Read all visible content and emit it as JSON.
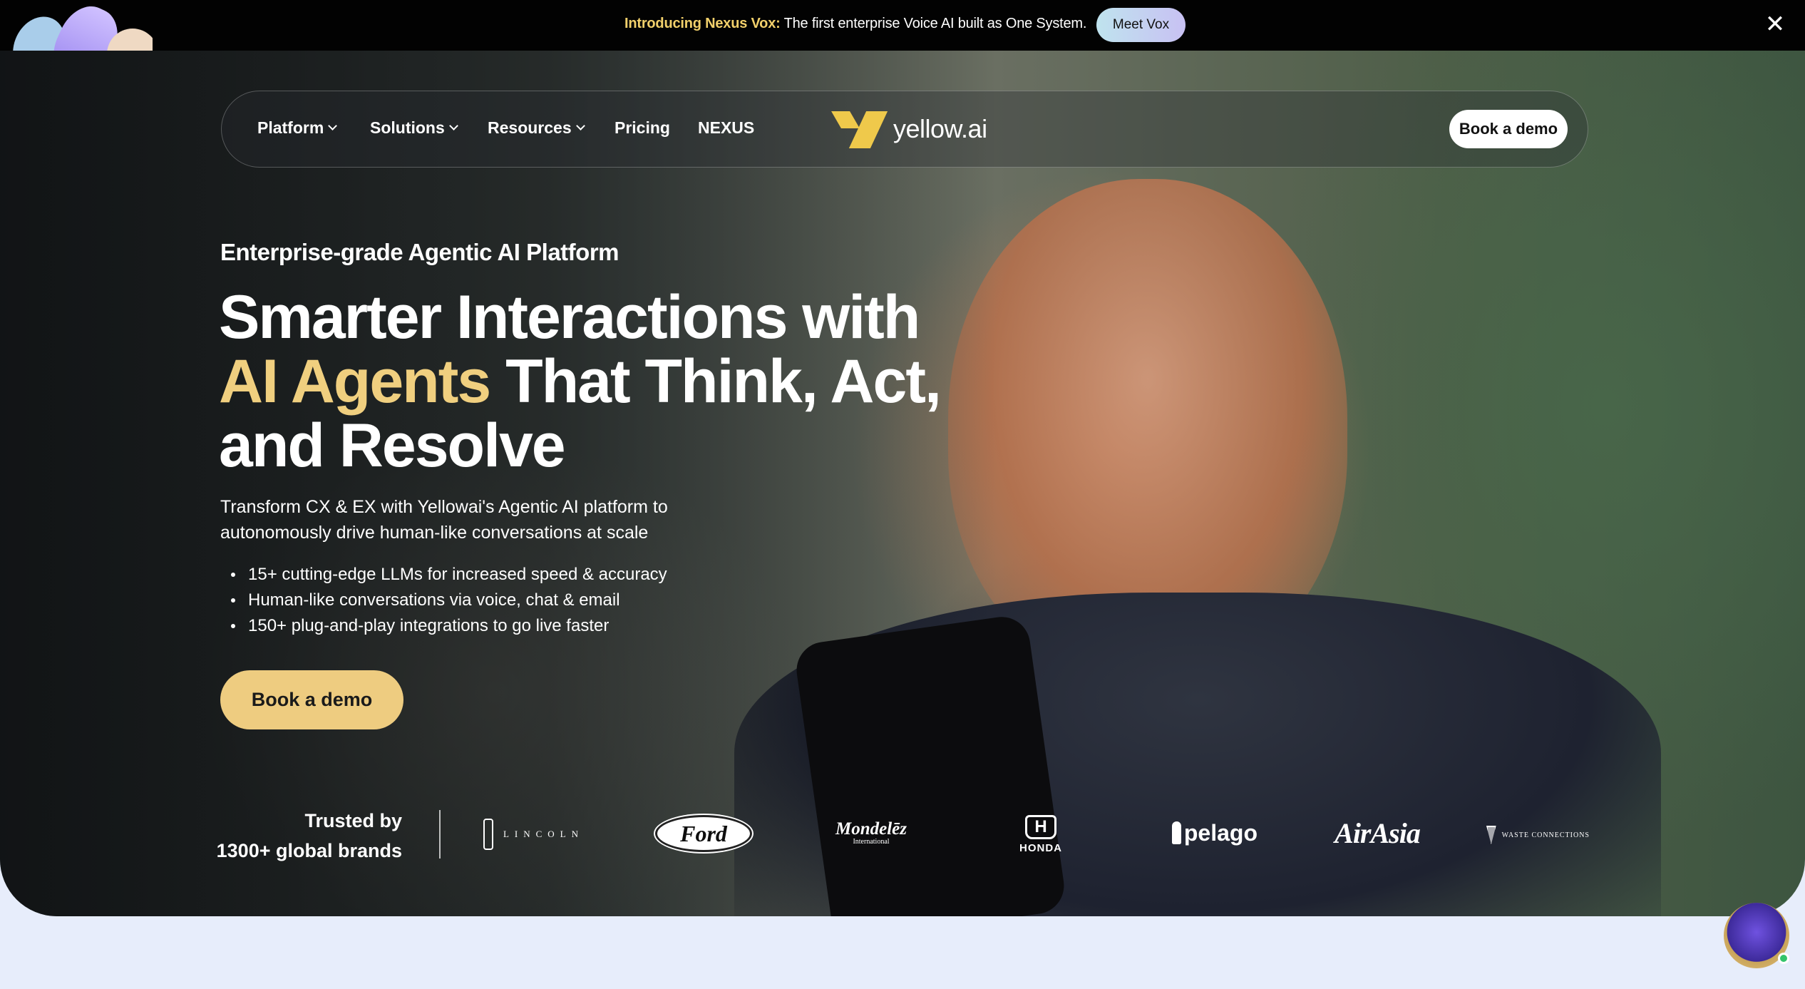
{
  "announcement": {
    "highlight": "Introducing Nexus Vox:",
    "text": "The first enterprise Voice AI built as One System.",
    "button_label": "Meet Vox",
    "close_symbol": "✕"
  },
  "nav": {
    "items": [
      {
        "label": "Platform",
        "has_dropdown": true
      },
      {
        "label": "Solutions",
        "has_dropdown": true
      },
      {
        "label": "Resources",
        "has_dropdown": true
      },
      {
        "label": "Pricing",
        "has_dropdown": false
      },
      {
        "label": "NEXUS",
        "has_dropdown": false
      }
    ],
    "logo_text": "yellow.ai",
    "cta_label": "Book a demo"
  },
  "hero": {
    "eyebrow": "Enterprise-grade Agentic AI Platform",
    "headline_line1": "Smarter Interactions with",
    "headline_highlight": "AI Agents",
    "headline_line2_rest": "That Think, Act,",
    "headline_line3": "and Resolve",
    "subtitle": "Transform CX & EX with Yellowai's Agentic AI platform to autonomously drive human-like conversations at scale",
    "bullets": [
      "15+ cutting-edge LLMs for increased speed & accuracy",
      "Human-like conversations via voice, chat & email",
      "150+ plug-and-play integrations to go live faster"
    ],
    "cta_label": "Book a demo"
  },
  "trusted": {
    "line1": "Trusted by",
    "line2": "1300+ global brands",
    "brands": {
      "lincoln": "LINCOLN",
      "ford": "Ford",
      "mondelez": "Mondelēz",
      "mondelez_sub": "International",
      "honda_mark": "H",
      "honda": "HONDA",
      "pelago": "pelago",
      "airasia": "AirAsia",
      "waste": "WASTE CONNECTIONS"
    }
  },
  "colors": {
    "accent_gold": "#f0cf7f",
    "cta_gold": "#eecc80",
    "logo_yellow": "#efc94b",
    "topbar_bg": "#020202",
    "page_bg": "#e7edfb"
  },
  "icons": {
    "close": "close-icon",
    "dropdown": "chevron-down-icon",
    "chat": "chat-avatar-icon"
  }
}
